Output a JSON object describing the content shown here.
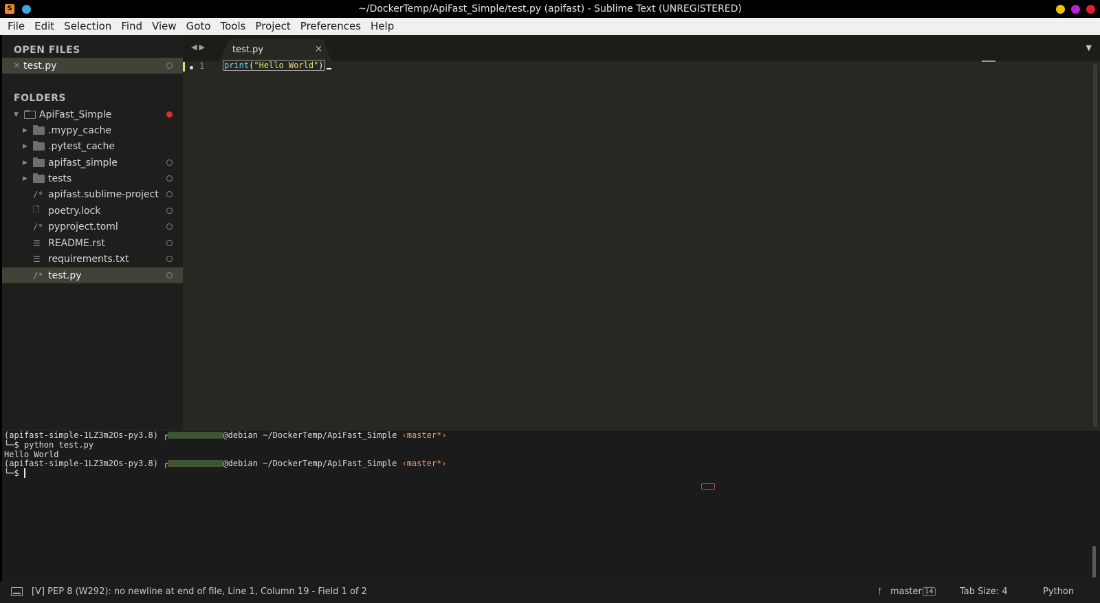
{
  "window": {
    "title": "~/DockerTemp/ApiFast_Simple/test.py (apifast) - Sublime Text (UNREGISTERED)"
  },
  "menu": [
    "File",
    "Edit",
    "Selection",
    "Find",
    "View",
    "Goto",
    "Tools",
    "Project",
    "Preferences",
    "Help"
  ],
  "sidebar": {
    "open_files_header": "OPEN FILES",
    "open_files": [
      {
        "label": "test.py"
      }
    ],
    "folders_header": "FOLDERS",
    "root_folder": "ApiFast_Simple",
    "items": [
      {
        "label": ".mypy_cache",
        "kind": "folder"
      },
      {
        "label": ".pytest_cache",
        "kind": "folder"
      },
      {
        "label": "apifast_simple",
        "kind": "folder"
      },
      {
        "label": "tests",
        "kind": "folder"
      },
      {
        "label": "apifast.sublime-project",
        "kind": "code"
      },
      {
        "label": "poetry.lock",
        "kind": "doc"
      },
      {
        "label": "pyproject.toml",
        "kind": "code"
      },
      {
        "label": "README.rst",
        "kind": "text"
      },
      {
        "label": "requirements.txt",
        "kind": "text"
      },
      {
        "label": "test.py",
        "kind": "code"
      }
    ]
  },
  "tabs": [
    {
      "label": "test.py",
      "close": "×"
    }
  ],
  "editor": {
    "line_number": "1",
    "code": {
      "fn": "print",
      "open": "(",
      "str": "\"Hello World\"",
      "close": ")"
    }
  },
  "terminal": {
    "env": "(apifast-simple-1LZ3m2Os-py3.8)",
    "host": "@debian",
    "path": "~/DockerTemp/ApiFast_Simple",
    "branch": "‹master*›",
    "command": "└─$ python test.py",
    "output": "Hello World",
    "prompt": "└─$ "
  },
  "status": {
    "message": "[V] PEP 8 (W292): no newline at end of file, Line 1, Column 19 - Field 1 of 2",
    "branch": "master",
    "branch_count": "14",
    "tab_size": "Tab Size: 4",
    "syntax": "Python"
  },
  "colors": {
    "background": "#272822",
    "sidebar": "#1e1f1c",
    "accent_dirty": "#e02c2c",
    "string": "#e6db74",
    "function": "#66d9ef"
  }
}
